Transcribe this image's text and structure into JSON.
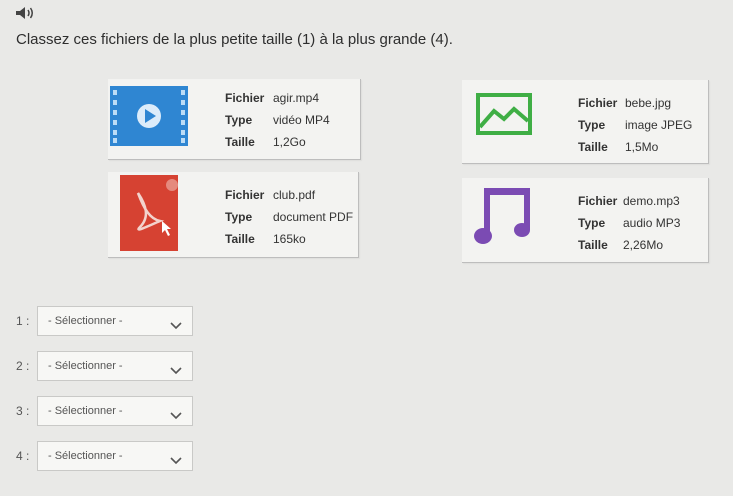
{
  "instruction": "Classez ces fichiers de la plus petite taille (1) à la plus grande (4).",
  "labels": {
    "file": "Fichier",
    "type": "Type",
    "size": "Taille"
  },
  "files": [
    {
      "name": "agir.mp4",
      "type": "vidéo MP4",
      "size": "1,2Go",
      "icon": "video-icon",
      "color": "#2f86d2"
    },
    {
      "name": "bebe.jpg",
      "type": "image JPEG",
      "size": "1,5Mo",
      "icon": "image-icon",
      "color": "#3fae45"
    },
    {
      "name": "club.pdf",
      "type": "document PDF",
      "size": "165ko",
      "icon": "pdf-icon",
      "color": "#d64232"
    },
    {
      "name": "demo.mp3",
      "type": "audio MP3",
      "size": "2,26Mo",
      "icon": "music-note-icon",
      "color": "#7b4bb3"
    }
  ],
  "ranks": [
    {
      "num": "1 :",
      "value": "- Sélectionner -"
    },
    {
      "num": "2 :",
      "value": "- Sélectionner -"
    },
    {
      "num": "3 :",
      "value": "- Sélectionner -"
    },
    {
      "num": "4 :",
      "value": "- Sélectionner -"
    }
  ],
  "icons": {
    "audio": "speaker-icon",
    "dropdown": "chevron-down-icon"
  }
}
